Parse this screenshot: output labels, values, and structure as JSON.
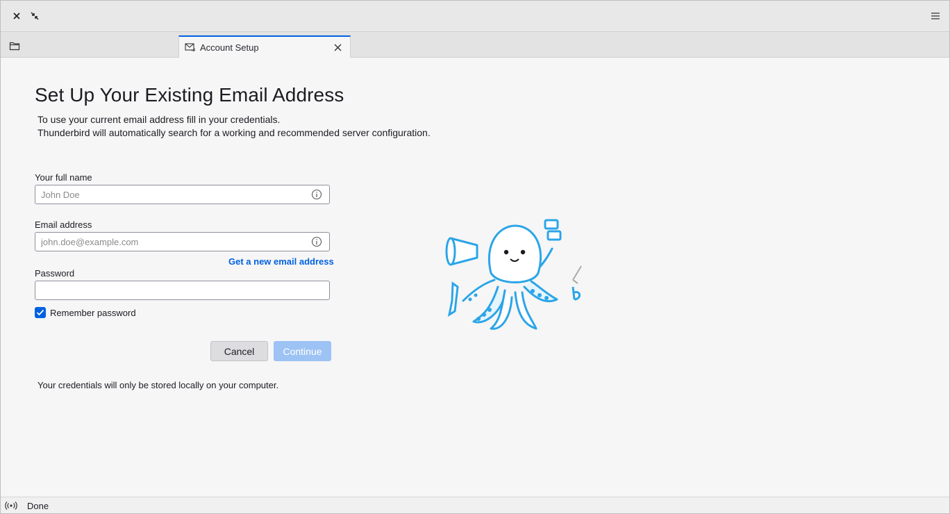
{
  "window": {
    "close_icon": "close-icon",
    "restore_icon": "restore-icon",
    "menu_icon": "hamburger-menu-icon"
  },
  "tabs": [
    {
      "label": "Account Setup",
      "icon": "envelope-icon",
      "active": true
    }
  ],
  "form": {
    "title": "Set Up Your Existing Email Address",
    "intro_line1": "To use your current email address fill in your credentials.",
    "intro_line2": "Thunderbird will automatically search for a working and recommended server configuration.",
    "full_name_label": "Your full name",
    "full_name_placeholder": "John Doe",
    "full_name_value": "",
    "email_label": "Email address",
    "email_placeholder": "john.doe@example.com",
    "email_value": "",
    "get_new_email_link": "Get a new email address",
    "password_label": "Password",
    "password_value": "",
    "remember_password_label": "Remember password",
    "remember_password_checked": true,
    "cancel_label": "Cancel",
    "continue_label": "Continue",
    "storage_note": "Your credentials will only be stored locally on your computer."
  },
  "status": {
    "text": "Done",
    "icon": "online-status-icon"
  },
  "colors": {
    "accent": "#0061e0",
    "continue_disabled": "#9dc2f4",
    "mascot": "#2ba5e8"
  }
}
